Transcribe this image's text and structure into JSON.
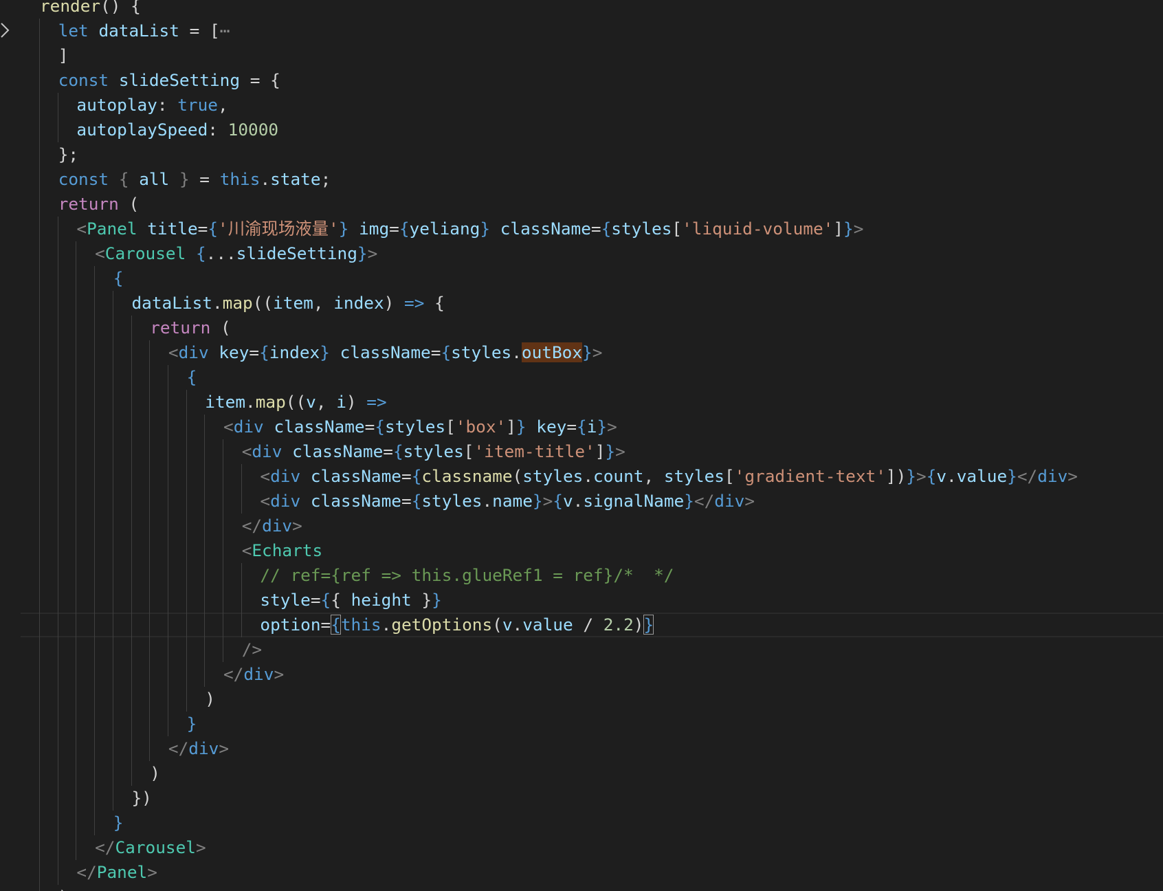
{
  "editor": {
    "language": "javascript-jsx",
    "theme_colors": {
      "background": "#1e1e1e",
      "keyword": "#569cd6",
      "control": "#c586c0",
      "variable": "#9cdcfe",
      "function": "#dcdcaa",
      "string": "#ce9178",
      "number": "#b5cea8",
      "component": "#4ec9b0",
      "comment": "#6a9955",
      "punctuation": "#d4d4d4"
    },
    "folded_line": 2,
    "cursor_line": 26,
    "highlighted_word": "outBox",
    "lines": [
      {
        "tokens": [
          [
            "fn",
            "render"
          ],
          [
            "pn",
            "() {"
          ]
        ]
      },
      {
        "tokens": [
          [
            "kw",
            "let"
          ],
          [
            "pn",
            " "
          ],
          [
            "var",
            "dataList"
          ],
          [
            "pn",
            " = ["
          ],
          [
            "fold-ellipsis",
            "⋯"
          ]
        ]
      },
      {
        "tokens": [
          [
            "pn",
            "]"
          ]
        ]
      },
      {
        "tokens": [
          [
            "kw",
            "const"
          ],
          [
            "pn",
            " "
          ],
          [
            "var",
            "slideSetting"
          ],
          [
            "pn",
            " = {"
          ]
        ]
      },
      {
        "tokens": [
          [
            "var",
            "autoplay"
          ],
          [
            "pn",
            ": "
          ],
          [
            "kw",
            "true"
          ],
          [
            "pn",
            ","
          ]
        ]
      },
      {
        "tokens": [
          [
            "var",
            "autoplaySpeed"
          ],
          [
            "pn",
            ": "
          ],
          [
            "num",
            "10000"
          ]
        ]
      },
      {
        "tokens": [
          [
            "pn",
            "};"
          ]
        ]
      },
      {
        "tokens": [
          [
            "kw",
            "const"
          ],
          [
            "pn",
            " "
          ],
          [
            "br",
            "{"
          ],
          [
            "pn",
            " "
          ],
          [
            "var",
            "all"
          ],
          [
            "pn",
            " "
          ],
          [
            "br",
            "}"
          ],
          [
            "pn",
            " = "
          ],
          [
            "kw",
            "this"
          ],
          [
            "pn",
            "."
          ],
          [
            "var",
            "state"
          ],
          [
            "pn",
            ";"
          ]
        ]
      },
      {
        "tokens": [
          [
            "ctl",
            "return"
          ],
          [
            "pn",
            " ("
          ]
        ]
      },
      {
        "tokens": [
          [
            "br",
            "<"
          ],
          [
            "tag",
            "Panel"
          ],
          [
            "pn",
            " "
          ],
          [
            "var",
            "title"
          ],
          [
            "pn",
            "="
          ],
          [
            "brc",
            "{"
          ],
          [
            "str",
            "'川渝现场液量'"
          ],
          [
            "brc",
            "}"
          ],
          [
            "pn",
            " "
          ],
          [
            "var",
            "img"
          ],
          [
            "pn",
            "="
          ],
          [
            "brc",
            "{"
          ],
          [
            "var",
            "yeliang"
          ],
          [
            "brc",
            "}"
          ],
          [
            "pn",
            " "
          ],
          [
            "var",
            "className"
          ],
          [
            "pn",
            "="
          ],
          [
            "brc",
            "{"
          ],
          [
            "var",
            "styles"
          ],
          [
            "pn",
            "["
          ],
          [
            "str",
            "'liquid-volume'"
          ],
          [
            "pn",
            "]"
          ],
          [
            "brc",
            "}"
          ],
          [
            "br",
            ">"
          ]
        ]
      },
      {
        "tokens": [
          [
            "br",
            "<"
          ],
          [
            "tag",
            "Carousel"
          ],
          [
            "pn",
            " "
          ],
          [
            "brc",
            "{"
          ],
          [
            "pn",
            "..."
          ],
          [
            "var",
            "slideSetting"
          ],
          [
            "brc",
            "}"
          ],
          [
            "br",
            ">"
          ]
        ]
      },
      {
        "tokens": [
          [
            "brc",
            "{"
          ]
        ]
      },
      {
        "tokens": [
          [
            "var",
            "dataList"
          ],
          [
            "pn",
            "."
          ],
          [
            "fn",
            "map"
          ],
          [
            "pn",
            "(("
          ],
          [
            "var",
            "item"
          ],
          [
            "pn",
            ", "
          ],
          [
            "var",
            "index"
          ],
          [
            "pn",
            ") "
          ],
          [
            "kw",
            "=>"
          ],
          [
            "pn",
            " {"
          ]
        ]
      },
      {
        "tokens": [
          [
            "ctl",
            "return"
          ],
          [
            "pn",
            " ("
          ]
        ]
      },
      {
        "tokens": [
          [
            "br",
            "<"
          ],
          [
            "htag",
            "div"
          ],
          [
            "pn",
            " "
          ],
          [
            "var",
            "key"
          ],
          [
            "pn",
            "="
          ],
          [
            "brc",
            "{"
          ],
          [
            "var",
            "index"
          ],
          [
            "brc",
            "}"
          ],
          [
            "pn",
            " "
          ],
          [
            "var",
            "className"
          ],
          [
            "pn",
            "="
          ],
          [
            "brc",
            "{"
          ],
          [
            "var",
            "styles"
          ],
          [
            "pn",
            "."
          ],
          [
            "hl",
            "outBox"
          ],
          [
            "brc",
            "}"
          ],
          [
            "br",
            ">"
          ]
        ]
      },
      {
        "tokens": [
          [
            "brc",
            "{"
          ]
        ]
      },
      {
        "tokens": [
          [
            "var",
            "item"
          ],
          [
            "pn",
            "."
          ],
          [
            "fn",
            "map"
          ],
          [
            "pn",
            "(("
          ],
          [
            "var",
            "v"
          ],
          [
            "pn",
            ", "
          ],
          [
            "var",
            "i"
          ],
          [
            "pn",
            ") "
          ],
          [
            "kw",
            "=>"
          ]
        ]
      },
      {
        "tokens": [
          [
            "br",
            "<"
          ],
          [
            "htag",
            "div"
          ],
          [
            "pn",
            " "
          ],
          [
            "var",
            "className"
          ],
          [
            "pn",
            "="
          ],
          [
            "brc",
            "{"
          ],
          [
            "var",
            "styles"
          ],
          [
            "pn",
            "["
          ],
          [
            "str",
            "'box'"
          ],
          [
            "pn",
            "]"
          ],
          [
            "brc",
            "}"
          ],
          [
            "pn",
            " "
          ],
          [
            "var",
            "key"
          ],
          [
            "pn",
            "="
          ],
          [
            "brc",
            "{"
          ],
          [
            "var",
            "i"
          ],
          [
            "brc",
            "}"
          ],
          [
            "br",
            ">"
          ]
        ]
      },
      {
        "tokens": [
          [
            "br",
            "<"
          ],
          [
            "htag",
            "div"
          ],
          [
            "pn",
            " "
          ],
          [
            "var",
            "className"
          ],
          [
            "pn",
            "="
          ],
          [
            "brc",
            "{"
          ],
          [
            "var",
            "styles"
          ],
          [
            "pn",
            "["
          ],
          [
            "str",
            "'item-title'"
          ],
          [
            "pn",
            "]"
          ],
          [
            "brc",
            "}"
          ],
          [
            "br",
            ">"
          ]
        ]
      },
      {
        "tokens": [
          [
            "br",
            "<"
          ],
          [
            "htag",
            "div"
          ],
          [
            "pn",
            " "
          ],
          [
            "var",
            "className"
          ],
          [
            "pn",
            "="
          ],
          [
            "brc",
            "{"
          ],
          [
            "fn",
            "classname"
          ],
          [
            "pn",
            "("
          ],
          [
            "var",
            "styles"
          ],
          [
            "pn",
            "."
          ],
          [
            "var",
            "count"
          ],
          [
            "pn",
            ", "
          ],
          [
            "var",
            "styles"
          ],
          [
            "pn",
            "["
          ],
          [
            "str",
            "'gradient-text'"
          ],
          [
            "pn",
            "])"
          ],
          [
            "brc",
            "}"
          ],
          [
            "br",
            ">"
          ],
          [
            "brc",
            "{"
          ],
          [
            "var",
            "v"
          ],
          [
            "pn",
            "."
          ],
          [
            "var",
            "value"
          ],
          [
            "brc",
            "}"
          ],
          [
            "br",
            "</"
          ],
          [
            "htag",
            "div"
          ],
          [
            "br",
            ">"
          ]
        ]
      },
      {
        "tokens": [
          [
            "br",
            "<"
          ],
          [
            "htag",
            "div"
          ],
          [
            "pn",
            " "
          ],
          [
            "var",
            "className"
          ],
          [
            "pn",
            "="
          ],
          [
            "brc",
            "{"
          ],
          [
            "var",
            "styles"
          ],
          [
            "pn",
            "."
          ],
          [
            "var",
            "name"
          ],
          [
            "brc",
            "}"
          ],
          [
            "br",
            ">"
          ],
          [
            "brc",
            "{"
          ],
          [
            "var",
            "v"
          ],
          [
            "pn",
            "."
          ],
          [
            "var",
            "signalName"
          ],
          [
            "brc",
            "}"
          ],
          [
            "br",
            "</"
          ],
          [
            "htag",
            "div"
          ],
          [
            "br",
            ">"
          ]
        ]
      },
      {
        "tokens": [
          [
            "br",
            "</"
          ],
          [
            "htag",
            "div"
          ],
          [
            "br",
            ">"
          ]
        ]
      },
      {
        "tokens": [
          [
            "br",
            "<"
          ],
          [
            "tag",
            "Echarts"
          ]
        ]
      },
      {
        "tokens": [
          [
            "cm",
            "// ref={ref => this.glueRef1 = ref}/*  */"
          ]
        ]
      },
      {
        "tokens": [
          [
            "var",
            "style"
          ],
          [
            "pn",
            "="
          ],
          [
            "brc",
            "{"
          ],
          [
            "pn",
            "{ "
          ],
          [
            "var",
            "height"
          ],
          [
            "pn",
            " }"
          ],
          [
            "brc",
            "}"
          ]
        ]
      },
      {
        "tokens": [
          [
            "var",
            "option"
          ],
          [
            "pn",
            "="
          ],
          [
            "bm",
            "{"
          ],
          [
            "kw",
            "this"
          ],
          [
            "pn",
            "."
          ],
          [
            "fn",
            "getOptions"
          ],
          [
            "pn",
            "("
          ],
          [
            "var",
            "v"
          ],
          [
            "pn",
            "."
          ],
          [
            "var",
            "value"
          ],
          [
            "pn",
            " / "
          ],
          [
            "num",
            "2.2"
          ],
          [
            "pn",
            ")"
          ],
          [
            "bm",
            "}"
          ]
        ]
      },
      {
        "tokens": [
          [
            "br",
            "/>"
          ]
        ]
      },
      {
        "tokens": [
          [
            "br",
            "</"
          ],
          [
            "htag",
            "div"
          ],
          [
            "br",
            ">"
          ]
        ]
      },
      {
        "tokens": [
          [
            "pn",
            ")"
          ]
        ]
      },
      {
        "tokens": [
          [
            "brc",
            "}"
          ]
        ]
      },
      {
        "tokens": [
          [
            "br",
            "</"
          ],
          [
            "htag",
            "div"
          ],
          [
            "br",
            ">"
          ]
        ]
      },
      {
        "tokens": [
          [
            "pn",
            ")"
          ]
        ]
      },
      {
        "tokens": [
          [
            "pn",
            "})"
          ]
        ]
      },
      {
        "tokens": [
          [
            "brc",
            "}"
          ]
        ]
      },
      {
        "tokens": [
          [
            "br",
            "</"
          ],
          [
            "tag",
            "Carousel"
          ],
          [
            "br",
            ">"
          ]
        ]
      },
      {
        "tokens": [
          [
            "br",
            "</"
          ],
          [
            "tag",
            "Panel"
          ],
          [
            "br",
            ">"
          ]
        ]
      },
      {
        "tokens": [
          [
            "pn",
            ");"
          ]
        ]
      }
    ]
  }
}
